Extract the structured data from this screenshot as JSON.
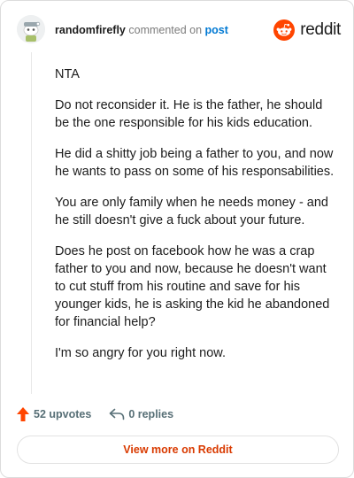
{
  "header": {
    "username": "randomfirefly",
    "action_text": " commented on ",
    "post_link": "post",
    "brand": "reddit",
    "brand_color": "#ff4500"
  },
  "comment": {
    "paragraphs": [
      "NTA",
      "Do not reconsider it. He is the father, he should be the one responsible for his kids education.",
      "He did a shitty job being a father to you, and now he wants to pass on some of his responsabilities.",
      "You are only family when he needs money - and he still doesn't give a fuck about your future.",
      "Does he post on facebook how he was a crap father to you and now, because he doesn't want to cut stuff from his routine and save for his younger kids, he is asking the kid he abandoned for financial help?",
      "I'm so angry for you right now."
    ]
  },
  "actions": {
    "upvotes": "52 upvotes",
    "replies": "0 replies",
    "upvote_icon": "upvote-arrow-icon",
    "reply_icon": "reply-arrow-icon"
  },
  "footer": {
    "view_more": "View more on Reddit",
    "accent": "#d93a00"
  }
}
